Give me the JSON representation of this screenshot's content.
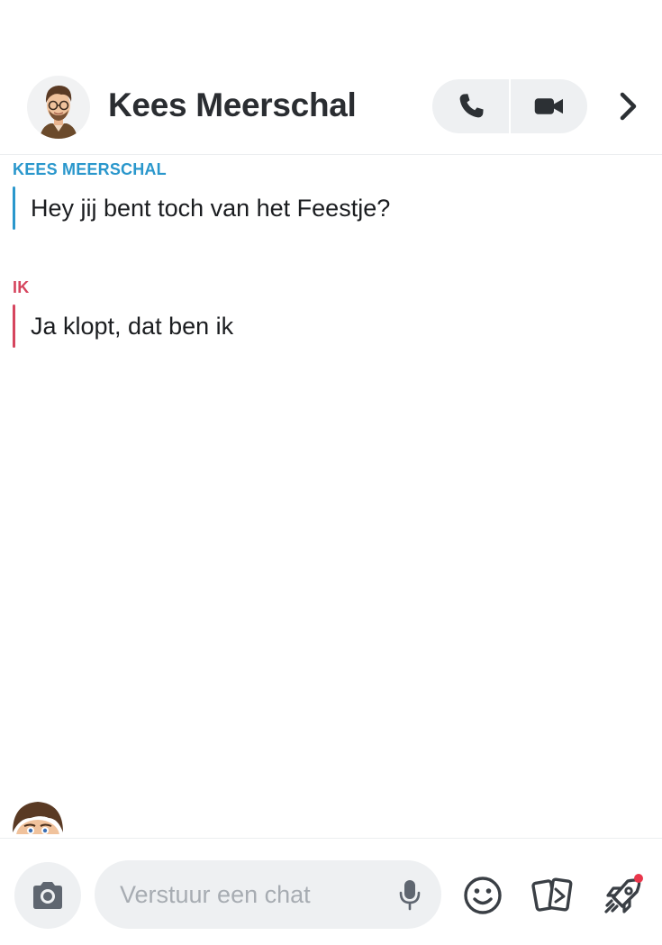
{
  "header": {
    "contact_name": "Kees Meerschal",
    "avatar_icon": "bitmoji-avatar-icon",
    "call_icon": "phone-icon",
    "video_icon": "video-camera-icon",
    "more_icon": "chevron-right-icon"
  },
  "messages": [
    {
      "sender": "KEES MEERSCHAL",
      "text": "Hey jij bent toch van het Feestje?",
      "color": "#2a97cc"
    },
    {
      "sender": "IK",
      "text": "Ja klopt, dat ben ik",
      "color": "#d6455e"
    }
  ],
  "composer": {
    "placeholder": "Verstuur een chat",
    "value": "",
    "camera_icon": "camera-icon",
    "mic_icon": "microphone-icon",
    "emoji_icon": "smiley-icon",
    "stickers_icon": "cards-icon",
    "games_icon": "rocket-icon",
    "notification_dot_color": "#e9364b"
  }
}
